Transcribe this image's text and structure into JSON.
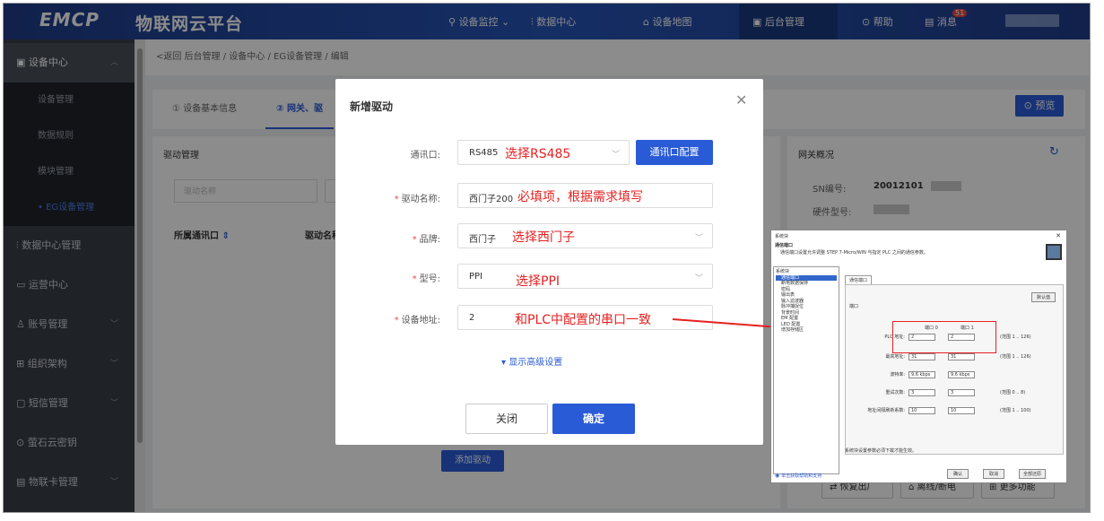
{
  "header": {
    "logo": "EMCP",
    "platform": "物联网云平台",
    "nav": [
      "设备监控",
      "数据中心",
      "设备地图",
      "后台管理",
      "帮助",
      "消息"
    ],
    "badge": "51"
  },
  "sidebar": {
    "device_center": "设备中心",
    "sub": [
      "设备管理",
      "数据规则",
      "模块管理",
      "EG设备管理"
    ],
    "groups": [
      "数据中心管理",
      "运营中心",
      "账号管理",
      "组织架构",
      "短信管理",
      "萤石云密钥",
      "物联卡管理"
    ]
  },
  "breadcrumb": "<返回  后台管理  /  设备中心  /  EG设备管理  /  编辑",
  "tabs": [
    "① 设备基本信息",
    "② 网关、驱"
  ],
  "preview_label": "预览",
  "driver_card": {
    "title": "驱动管理",
    "search_placeholder": "驱动名称",
    "col1": "所属通讯口",
    "col2": "驱动名称",
    "add_label": "添加驱动"
  },
  "gateway_card": {
    "title": "网关概况",
    "sn_label": "SN编号:",
    "sn_value": "20012101",
    "hw_label": "硬件型号:"
  },
  "bottom_buttons": [
    "恢复出厂",
    "离线/断电",
    "更多功能"
  ],
  "modal": {
    "title": "新增驱动",
    "port_label": "通讯口:",
    "port_value": "RS485",
    "port_note": "选择RS485",
    "port_button": "通讯口配置",
    "name_label": "驱动名称:",
    "name_value": "西门子200",
    "name_note": "必填项，根据需求填写",
    "brand_label": "品牌:",
    "brand_value": "西门子",
    "brand_note": "选择西门子",
    "model_label": "型号:",
    "model_value": "PPI",
    "model_note": "选择PPI",
    "addr_label": "设备地址:",
    "addr_value": "2",
    "addr_note": "和PLC中配置的串口一致",
    "advanced": "显示高级设置",
    "close": "关闭",
    "confirm": "确定"
  },
  "screenshot": {
    "window_title": "系统块",
    "section": "通信端口",
    "desc": "通信端口设置允许调整 STEP 7-Micro/WIN 与指定 PLC 之间的通信参数。",
    "tree": [
      "系统块",
      "通信端口",
      "断电数据保持",
      "密码",
      "输出表",
      "输入滤波器",
      "脉冲捕捉位",
      "背景时间",
      "EM 配置",
      "LED 配置",
      "增加存储区"
    ],
    "tab": "通信端口",
    "default_btn": "默认值",
    "port_group": "端口",
    "port0": "端口 0",
    "port1": "端口 1",
    "rows": [
      {
        "label": "PLC 地址:",
        "p0": "2",
        "p1": "2",
        "range": "(范围 1 .. 126)"
      },
      {
        "label": "最高地址:",
        "p0": "31",
        "p1": "31",
        "range": "(范围 1 .. 126)"
      },
      {
        "label": "波特率:",
        "p0": "9.6 kbps",
        "p1": "9.6 kbps",
        "range": ""
      },
      {
        "label": "重试次数:",
        "p0": "3",
        "p1": "3",
        "range": "(范围 0 .. 8)"
      },
      {
        "label": "地址间隔刷新系数:",
        "p0": "10",
        "p1": "10",
        "range": "(范围 1 .. 100)"
      }
    ],
    "footer_note": "系统块设置参数必须下载才能生效。",
    "help_link": "单击获取帮助和支持",
    "btn_ok": "确认",
    "btn_cancel": "取消",
    "btn_apply": "全部还原"
  }
}
